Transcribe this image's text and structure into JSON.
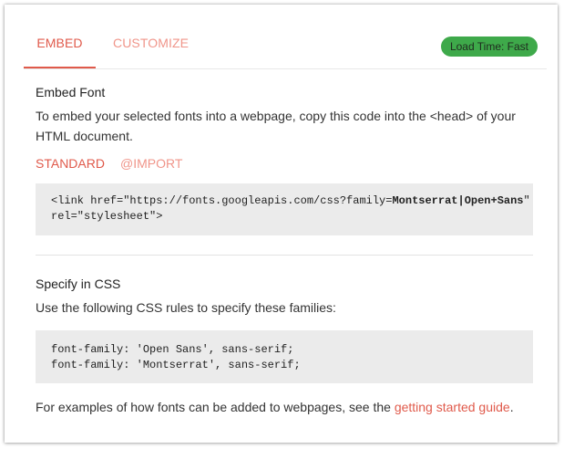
{
  "tabs": {
    "embed": "EMBED",
    "customize": "CUSTOMIZE"
  },
  "badge": {
    "label": "Load Time: Fast"
  },
  "embed_section": {
    "title": "Embed Font",
    "description": "To embed your selected fonts into a webpage, copy this code into the <head> of your HTML document.",
    "subtabs": {
      "standard": "STANDARD",
      "import": "@IMPORT"
    },
    "code": {
      "line1_prefix": "<link href=\"https://fonts.googleapis.com/css?family=",
      "family_1": "Montserrat",
      "separator": "|",
      "family_2": "Open+Sans",
      "line1_suffix": "\"",
      "line2": "rel=\"stylesheet\">"
    }
  },
  "css_section": {
    "title": "Specify in CSS",
    "description": "Use the following CSS rules to specify these families:",
    "rules": [
      "font-family: 'Open Sans', sans-serif;",
      "font-family: 'Montserrat', sans-serif;"
    ]
  },
  "footer": {
    "text_before": "For examples of how fonts can be added to webpages, see the ",
    "link": "getting started guide",
    "text_after": "."
  },
  "colors": {
    "accent": "#e05a4b",
    "accent_light": "#f0958a",
    "badge_green": "#3ea94a",
    "code_bg": "#ebebeb"
  }
}
